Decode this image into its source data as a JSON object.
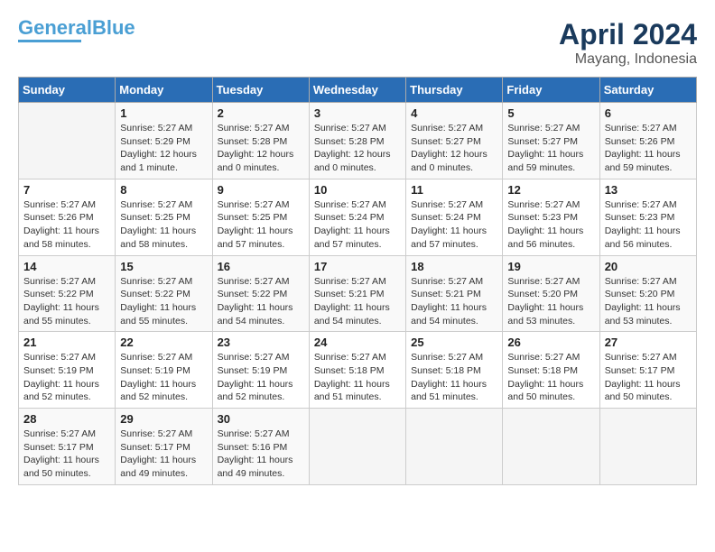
{
  "header": {
    "logo_line1": "General",
    "logo_line2": "Blue",
    "month_year": "April 2024",
    "location": "Mayang, Indonesia"
  },
  "weekdays": [
    "Sunday",
    "Monday",
    "Tuesday",
    "Wednesday",
    "Thursday",
    "Friday",
    "Saturday"
  ],
  "weeks": [
    [
      {
        "day": "",
        "info": ""
      },
      {
        "day": "1",
        "info": "Sunrise: 5:27 AM\nSunset: 5:29 PM\nDaylight: 12 hours\nand 1 minute."
      },
      {
        "day": "2",
        "info": "Sunrise: 5:27 AM\nSunset: 5:28 PM\nDaylight: 12 hours\nand 0 minutes."
      },
      {
        "day": "3",
        "info": "Sunrise: 5:27 AM\nSunset: 5:28 PM\nDaylight: 12 hours\nand 0 minutes."
      },
      {
        "day": "4",
        "info": "Sunrise: 5:27 AM\nSunset: 5:27 PM\nDaylight: 12 hours\nand 0 minutes."
      },
      {
        "day": "5",
        "info": "Sunrise: 5:27 AM\nSunset: 5:27 PM\nDaylight: 11 hours\nand 59 minutes."
      },
      {
        "day": "6",
        "info": "Sunrise: 5:27 AM\nSunset: 5:26 PM\nDaylight: 11 hours\nand 59 minutes."
      }
    ],
    [
      {
        "day": "7",
        "info": "Sunrise: 5:27 AM\nSunset: 5:26 PM\nDaylight: 11 hours\nand 58 minutes."
      },
      {
        "day": "8",
        "info": "Sunrise: 5:27 AM\nSunset: 5:25 PM\nDaylight: 11 hours\nand 58 minutes."
      },
      {
        "day": "9",
        "info": "Sunrise: 5:27 AM\nSunset: 5:25 PM\nDaylight: 11 hours\nand 57 minutes."
      },
      {
        "day": "10",
        "info": "Sunrise: 5:27 AM\nSunset: 5:24 PM\nDaylight: 11 hours\nand 57 minutes."
      },
      {
        "day": "11",
        "info": "Sunrise: 5:27 AM\nSunset: 5:24 PM\nDaylight: 11 hours\nand 57 minutes."
      },
      {
        "day": "12",
        "info": "Sunrise: 5:27 AM\nSunset: 5:23 PM\nDaylight: 11 hours\nand 56 minutes."
      },
      {
        "day": "13",
        "info": "Sunrise: 5:27 AM\nSunset: 5:23 PM\nDaylight: 11 hours\nand 56 minutes."
      }
    ],
    [
      {
        "day": "14",
        "info": "Sunrise: 5:27 AM\nSunset: 5:22 PM\nDaylight: 11 hours\nand 55 minutes."
      },
      {
        "day": "15",
        "info": "Sunrise: 5:27 AM\nSunset: 5:22 PM\nDaylight: 11 hours\nand 55 minutes."
      },
      {
        "day": "16",
        "info": "Sunrise: 5:27 AM\nSunset: 5:22 PM\nDaylight: 11 hours\nand 54 minutes."
      },
      {
        "day": "17",
        "info": "Sunrise: 5:27 AM\nSunset: 5:21 PM\nDaylight: 11 hours\nand 54 minutes."
      },
      {
        "day": "18",
        "info": "Sunrise: 5:27 AM\nSunset: 5:21 PM\nDaylight: 11 hours\nand 54 minutes."
      },
      {
        "day": "19",
        "info": "Sunrise: 5:27 AM\nSunset: 5:20 PM\nDaylight: 11 hours\nand 53 minutes."
      },
      {
        "day": "20",
        "info": "Sunrise: 5:27 AM\nSunset: 5:20 PM\nDaylight: 11 hours\nand 53 minutes."
      }
    ],
    [
      {
        "day": "21",
        "info": "Sunrise: 5:27 AM\nSunset: 5:19 PM\nDaylight: 11 hours\nand 52 minutes."
      },
      {
        "day": "22",
        "info": "Sunrise: 5:27 AM\nSunset: 5:19 PM\nDaylight: 11 hours\nand 52 minutes."
      },
      {
        "day": "23",
        "info": "Sunrise: 5:27 AM\nSunset: 5:19 PM\nDaylight: 11 hours\nand 52 minutes."
      },
      {
        "day": "24",
        "info": "Sunrise: 5:27 AM\nSunset: 5:18 PM\nDaylight: 11 hours\nand 51 minutes."
      },
      {
        "day": "25",
        "info": "Sunrise: 5:27 AM\nSunset: 5:18 PM\nDaylight: 11 hours\nand 51 minutes."
      },
      {
        "day": "26",
        "info": "Sunrise: 5:27 AM\nSunset: 5:18 PM\nDaylight: 11 hours\nand 50 minutes."
      },
      {
        "day": "27",
        "info": "Sunrise: 5:27 AM\nSunset: 5:17 PM\nDaylight: 11 hours\nand 50 minutes."
      }
    ],
    [
      {
        "day": "28",
        "info": "Sunrise: 5:27 AM\nSunset: 5:17 PM\nDaylight: 11 hours\nand 50 minutes."
      },
      {
        "day": "29",
        "info": "Sunrise: 5:27 AM\nSunset: 5:17 PM\nDaylight: 11 hours\nand 49 minutes."
      },
      {
        "day": "30",
        "info": "Sunrise: 5:27 AM\nSunset: 5:16 PM\nDaylight: 11 hours\nand 49 minutes."
      },
      {
        "day": "",
        "info": ""
      },
      {
        "day": "",
        "info": ""
      },
      {
        "day": "",
        "info": ""
      },
      {
        "day": "",
        "info": ""
      }
    ]
  ]
}
